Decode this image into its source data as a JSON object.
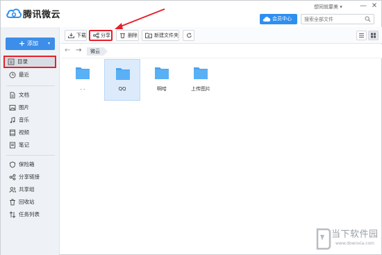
{
  "app": {
    "title": "腾讯微云",
    "user_name": "想同就要美 ▾",
    "minimize": "—",
    "close": "✕",
    "vip_label": "会员中心",
    "search_placeholder": "搜索全部文件"
  },
  "sidebar": {
    "add_label": "添加",
    "add_plus": "+",
    "add_caret": "▾",
    "items": [
      {
        "label": "目录",
        "icon": "directory-icon"
      },
      {
        "label": "最近",
        "icon": "clock-icon"
      },
      {
        "label": "文档",
        "icon": "document-icon"
      },
      {
        "label": "图片",
        "icon": "picture-icon"
      },
      {
        "label": "音乐",
        "icon": "music-icon"
      },
      {
        "label": "视频",
        "icon": "video-icon"
      },
      {
        "label": "笔记",
        "icon": "note-icon"
      },
      {
        "label": "保险箱",
        "icon": "safe-icon"
      },
      {
        "label": "分享链接",
        "icon": "share-link-icon"
      },
      {
        "label": "共享组",
        "icon": "group-icon"
      },
      {
        "label": "回收站",
        "icon": "trash-icon"
      },
      {
        "label": "任务列表",
        "icon": "task-list-icon"
      }
    ]
  },
  "toolbar": {
    "download": "下载",
    "share": "分享",
    "delete": "删除",
    "new_folder": "新建文件夹"
  },
  "breadcrumb": {
    "back": "←",
    "forward": "→",
    "current": "微云"
  },
  "files": [
    {
      "name": ". ."
    },
    {
      "name": "QQ"
    },
    {
      "name": "啊哈"
    },
    {
      "name": "上传图片"
    }
  ],
  "watermark": {
    "title": "当下软件园",
    "url": "www.downxia.com"
  },
  "colors": {
    "accent": "#3c8ee8",
    "highlight": "#e5202a",
    "folder": "#4aa3ef"
  }
}
